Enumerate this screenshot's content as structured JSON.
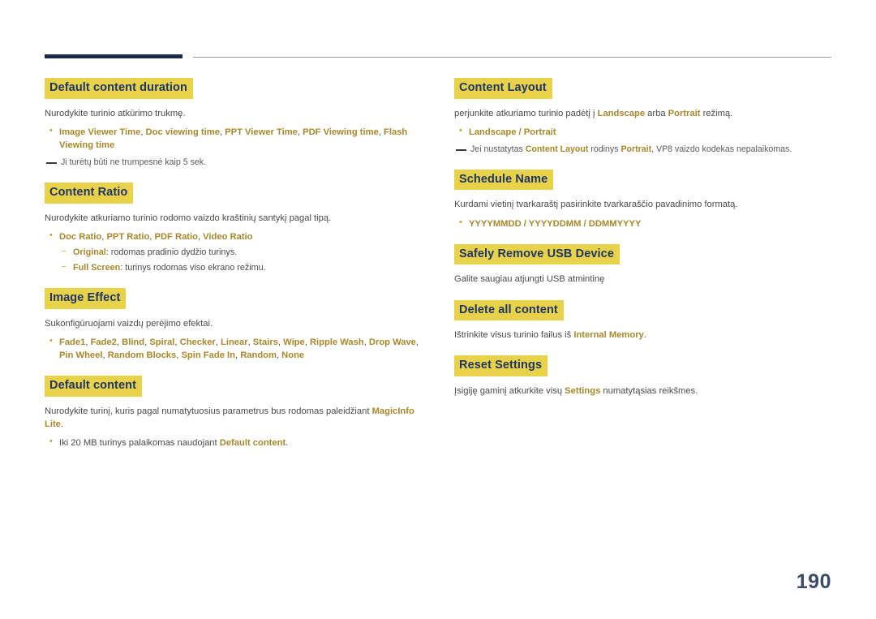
{
  "page_number": "190",
  "left_column": [
    {
      "heading": "Default content duration",
      "desc": "Nurodykite turinio atkūrimo trukmę.",
      "bullets": [
        {
          "parts": [
            {
              "t": "Image Viewer Time",
              "hl": true
            },
            {
              "t": ", ",
              "hl": false
            },
            {
              "t": "Doc viewing time",
              "hl": true
            },
            {
              "t": ", ",
              "hl": false
            },
            {
              "t": "PPT Viewer Time",
              "hl": true
            },
            {
              "t": ", ",
              "hl": false
            },
            {
              "t": "PDF Viewing time",
              "hl": true
            },
            {
              "t": ", ",
              "hl": false
            },
            {
              "t": "Flash Viewing time",
              "hl": true
            }
          ]
        }
      ],
      "note": "Ji turėtų būti ne trumpesnė kaip 5 sek."
    },
    {
      "heading": "Content Ratio",
      "desc": "Nurodykite atkuriamo turinio rodomo vaizdo kraštinių santykį pagal tipą.",
      "bullets": [
        {
          "parts": [
            {
              "t": "Doc Ratio",
              "hl": true
            },
            {
              "t": ", ",
              "hl": false
            },
            {
              "t": "PPT Ratio",
              "hl": true
            },
            {
              "t": ", ",
              "hl": false
            },
            {
              "t": "PDF Ratio",
              "hl": true
            },
            {
              "t": ", ",
              "hl": false
            },
            {
              "t": "Video Ratio",
              "hl": true
            }
          ],
          "sub": [
            [
              {
                "t": "Original",
                "hl": true
              },
              {
                "t": ": rodomas pradinio dydžio turinys.",
                "hl": false
              }
            ],
            [
              {
                "t": "Full Screen",
                "hl": true
              },
              {
                "t": ": turinys rodomas viso ekrano režimu.",
                "hl": false
              }
            ]
          ]
        }
      ]
    },
    {
      "heading": "Image Effect",
      "desc": "Sukonfigūruojami vaizdų perėjimo efektai.",
      "bullets": [
        {
          "parts": [
            {
              "t": "Fade1",
              "hl": true
            },
            {
              "t": ", ",
              "hl": false
            },
            {
              "t": "Fade2",
              "hl": true
            },
            {
              "t": ", ",
              "hl": false
            },
            {
              "t": "Blind",
              "hl": true
            },
            {
              "t": ", ",
              "hl": false
            },
            {
              "t": "Spiral",
              "hl": true
            },
            {
              "t": ", ",
              "hl": false
            },
            {
              "t": "Checker",
              "hl": true
            },
            {
              "t": ", ",
              "hl": false
            },
            {
              "t": "Linear",
              "hl": true
            },
            {
              "t": ", ",
              "hl": false
            },
            {
              "t": "Stairs",
              "hl": true
            },
            {
              "t": ", ",
              "hl": false
            },
            {
              "t": "Wipe",
              "hl": true
            },
            {
              "t": ", ",
              "hl": false
            },
            {
              "t": "Ripple Wash",
              "hl": true
            },
            {
              "t": ", ",
              "hl": false
            },
            {
              "t": "Drop Wave",
              "hl": true
            },
            {
              "t": ", ",
              "hl": false
            },
            {
              "t": "Pin Wheel",
              "hl": true
            },
            {
              "t": ", ",
              "hl": false
            },
            {
              "t": "Random Blocks",
              "hl": true
            },
            {
              "t": ", ",
              "hl": false
            },
            {
              "t": "Spin Fade In",
              "hl": true
            },
            {
              "t": ", ",
              "hl": false
            },
            {
              "t": "Random",
              "hl": true
            },
            {
              "t": ", ",
              "hl": false
            },
            {
              "t": "None",
              "hl": true
            }
          ]
        }
      ]
    },
    {
      "heading": "Default content",
      "desc_parts": [
        {
          "t": "Nurodykite turinį, kuris pagal numatytuosius parametrus bus rodomas paleidžiant ",
          "hl": false
        },
        {
          "t": "MagicInfo Lite",
          "hl": true
        },
        {
          "t": ".",
          "hl": false
        }
      ],
      "bullets": [
        {
          "parts": [
            {
              "t": "Iki 20 MB turinys palaikomas naudojant ",
              "hl": false
            },
            {
              "t": "Default content",
              "hl": true
            },
            {
              "t": ".",
              "hl": false
            }
          ]
        }
      ]
    }
  ],
  "right_column": [
    {
      "heading": "Content Layout",
      "desc_parts": [
        {
          "t": "perjunkite atkuriamo turinio padėtį į ",
          "hl": false
        },
        {
          "t": "Landscape",
          "hl": true
        },
        {
          "t": " arba ",
          "hl": false
        },
        {
          "t": "Portrait",
          "hl": true
        },
        {
          "t": " režimą.",
          "hl": false
        }
      ],
      "bullets": [
        {
          "parts": [
            {
              "t": "Landscape",
              "hl": true
            },
            {
              "t": " / ",
              "hl": true
            },
            {
              "t": "Portrait",
              "hl": true
            }
          ]
        }
      ],
      "note_parts": [
        {
          "t": "Jei nustatytas ",
          "hl": false
        },
        {
          "t": "Content Layout",
          "hl": true
        },
        {
          "t": " rodinys ",
          "hl": false
        },
        {
          "t": "Portrait",
          "hl": true
        },
        {
          "t": ", VP8 vaizdo kodekas nepalaikomas.",
          "hl": false
        }
      ]
    },
    {
      "heading": "Schedule Name",
      "desc": "Kurdami vietinį tvarkaraštį pasirinkite tvarkaraščio pavadinimo formatą.",
      "bullets": [
        {
          "parts": [
            {
              "t": "YYYYMMDD",
              "hl": true
            },
            {
              "t": " / ",
              "hl": true
            },
            {
              "t": "YYYYDDMM",
              "hl": true
            },
            {
              "t": " / ",
              "hl": true
            },
            {
              "t": "DDMMYYYY",
              "hl": true
            }
          ]
        }
      ]
    },
    {
      "heading": "Safely Remove USB Device",
      "desc": "Galite saugiau atjungti USB atmintinę"
    },
    {
      "heading": "Delete all content",
      "desc_parts": [
        {
          "t": "Ištrinkite visus turinio failus iš ",
          "hl": false
        },
        {
          "t": "Internal Memory",
          "hl": true
        },
        {
          "t": ".",
          "hl": false
        }
      ]
    },
    {
      "heading": "Reset Settings",
      "desc_parts": [
        {
          "t": "Įsigiję gaminį atkurkite visų ",
          "hl": false
        },
        {
          "t": "Settings",
          "hl": true
        },
        {
          "t": " numatytąsias reikšmes.",
          "hl": false
        }
      ]
    }
  ]
}
